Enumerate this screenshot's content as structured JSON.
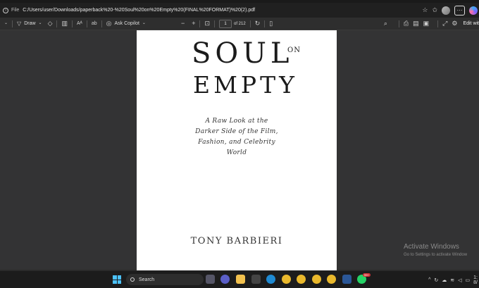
{
  "browser": {
    "file_chip": "File",
    "url": "C:/Users/user/Downloads/paperback%20-%20Soul%20on%20Empty%20(FINAL%20FORMAT)%20(2).pdf",
    "more_label": "···"
  },
  "toolbar": {
    "draw_label": "Draw",
    "ask_copilot_label": "Ask Copilot",
    "zoom_out": "−",
    "zoom_in": "+",
    "page_current": "1",
    "page_total": "of 212",
    "edit_label": "Edit wit"
  },
  "document": {
    "title_line1": "SOUL",
    "title_on": "ON",
    "title_line2": "EMPTY",
    "subtitle_line1": "A Raw Look at the",
    "subtitle_line2": "Darker Side of the Film,",
    "subtitle_line3": "Fashion, and Celebrity",
    "subtitle_line4": "World",
    "author": "TONY BARBIERI"
  },
  "watermark": {
    "title": "Activate Windows",
    "subtitle": "Go to Settings to activate Window"
  },
  "taskbar": {
    "search_label": "Search",
    "badge": "99+",
    "clock_time": "1:",
    "clock_date": "8/"
  },
  "colors": {
    "accent": "#4cc2ff",
    "background": "#333334"
  }
}
